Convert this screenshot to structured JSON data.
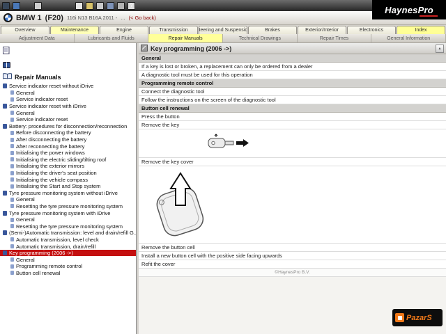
{
  "brand": {
    "part1": "Haynes",
    "part2": "Pro"
  },
  "toolbar": {
    "icons": [
      {
        "name": "computer-icon",
        "bg": "#37475a",
        "glyph": "",
        "gap": 0
      },
      {
        "name": "vehicle-select-icon",
        "bg": "#4a78b8",
        "glyph": "",
        "gap": 2
      },
      {
        "name": "document-icon",
        "bg": "#cfcfcf",
        "glyph": "",
        "gap": 18
      },
      {
        "name": "new-page-icon",
        "bg": "#e6e6e6",
        "glyph": "",
        "gap": 46
      },
      {
        "name": "open-folder-icon",
        "bg": "#d9c36a",
        "glyph": "",
        "gap": 2
      },
      {
        "name": "print-icon",
        "bg": "#c9c9c9",
        "glyph": "",
        "gap": 2
      },
      {
        "name": "save-icon",
        "bg": "#7e93b8",
        "glyph": "",
        "gap": 2
      },
      {
        "name": "settings-icon",
        "bg": "#b3b3b3",
        "glyph": "",
        "gap": 2
      },
      {
        "name": "help-icon",
        "bg": "#dcdcdc",
        "glyph": "?",
        "gap": 2
      }
    ]
  },
  "vehicle_bar": {
    "model": "BMW 1",
    "chassis_code": "(F20)",
    "engine": "116i N13 B16A 2011 -",
    "ellipsis": "...",
    "go_back": "(< Go back)"
  },
  "main_tabs": [
    {
      "label": "Overview"
    },
    {
      "label": "Maintenance",
      "active": true
    },
    {
      "label": "Engine"
    },
    {
      "label": "Transmission"
    },
    {
      "label": "Steering and Suspension"
    },
    {
      "label": "Brakes"
    },
    {
      "label": "Exterior/Interior"
    },
    {
      "label": "Electronics"
    },
    {
      "label": "Index",
      "accent": true
    }
  ],
  "sub_tabs": [
    {
      "label": "Adjustment Data"
    },
    {
      "label": "Lubricants and Fluids"
    },
    {
      "label": "Repair Manuals",
      "active": true
    },
    {
      "label": "Technical Drawings"
    },
    {
      "label": "Repair Times"
    },
    {
      "label": "General Information"
    }
  ],
  "sidebar": {
    "title": "Repair Manuals",
    "items": [
      {
        "level": 0,
        "label": "Service indicator reset without iDrive"
      },
      {
        "level": 1,
        "label": "General"
      },
      {
        "level": 1,
        "label": "Service indicator reset"
      },
      {
        "level": 0,
        "label": "Service indicator reset with iDrive"
      },
      {
        "level": 1,
        "label": "General"
      },
      {
        "level": 1,
        "label": "Service indicator reset"
      },
      {
        "level": 0,
        "label": "Battery: procedures for disconnection/reconnection"
      },
      {
        "level": 1,
        "label": "Before disconnecting the battery"
      },
      {
        "level": 1,
        "label": "After disconnecting the battery"
      },
      {
        "level": 1,
        "label": "After reconnecting the battery"
      },
      {
        "level": 1,
        "label": "Initialising the power windows"
      },
      {
        "level": 1,
        "label": "Initialising the electric sliding/tilting roof"
      },
      {
        "level": 1,
        "label": "Initialising the exterior mirrors"
      },
      {
        "level": 1,
        "label": "Initialising the driver's seat position"
      },
      {
        "level": 1,
        "label": "Initialising the vehicle compass"
      },
      {
        "level": 1,
        "label": "Initialising the Start and Stop system"
      },
      {
        "level": 0,
        "label": "Tyre pressure monitoring system without iDrive"
      },
      {
        "level": 1,
        "label": "General"
      },
      {
        "level": 1,
        "label": "Resetting the tyre pressure monitoring system"
      },
      {
        "level": 0,
        "label": "Tyre pressure monitoring system with iDrive"
      },
      {
        "level": 1,
        "label": "General"
      },
      {
        "level": 1,
        "label": "Resetting the tyre pressure monitoring system"
      },
      {
        "level": 0,
        "label": "(Semi-)Automatic transmission: level and drain/refill G..."
      },
      {
        "level": 1,
        "label": "Automatic transmission, level check"
      },
      {
        "level": 1,
        "label": "Automatic transmission, drain/refill"
      },
      {
        "level": 0,
        "label": "Key programming (2006 ->)",
        "selected": true
      },
      {
        "level": 1,
        "label": "General"
      },
      {
        "level": 1,
        "label": "Programming remote control"
      },
      {
        "level": 1,
        "label": "Button cell renewal"
      }
    ]
  },
  "content": {
    "title": "Key programming (2006 ->)",
    "header_button_glyph": "▲",
    "rows": [
      {
        "type": "section",
        "text": "General"
      },
      {
        "type": "step",
        "text": "If a key is lost or broken, a replacement can only be ordered from a dealer"
      },
      {
        "type": "step",
        "text": "A diagnostic tool must be used for this operation"
      },
      {
        "type": "section",
        "text": "Programming remote control"
      },
      {
        "type": "step",
        "text": "Connect the diagnostic tool"
      },
      {
        "type": "step",
        "text": "Follow the instructions on the screen of the diagnostic tool"
      },
      {
        "type": "section",
        "text": "Button cell renewal"
      },
      {
        "type": "step",
        "text": "Press the button"
      },
      {
        "type": "step",
        "text": "Remove the key"
      },
      {
        "type": "image",
        "name": "key-release-illustration"
      },
      {
        "type": "step",
        "text": "Remove the key cover"
      },
      {
        "type": "image",
        "name": "key-cover-removal-illustration"
      },
      {
        "type": "step",
        "text": "Remove the button cell"
      },
      {
        "type": "step",
        "text": "Install a new button cell with the positive side facing upwards"
      },
      {
        "type": "step",
        "text": "Refit the cover"
      },
      {
        "type": "footer",
        "text": "©HaynesPro B.V."
      }
    ]
  },
  "watermark": {
    "text": "PazarS"
  },
  "colors": {
    "selection_red": "#c40f0f",
    "accent_yellow": "#ffff99",
    "brand_red": "#cc2222",
    "watermark_orange": "#f07818"
  }
}
